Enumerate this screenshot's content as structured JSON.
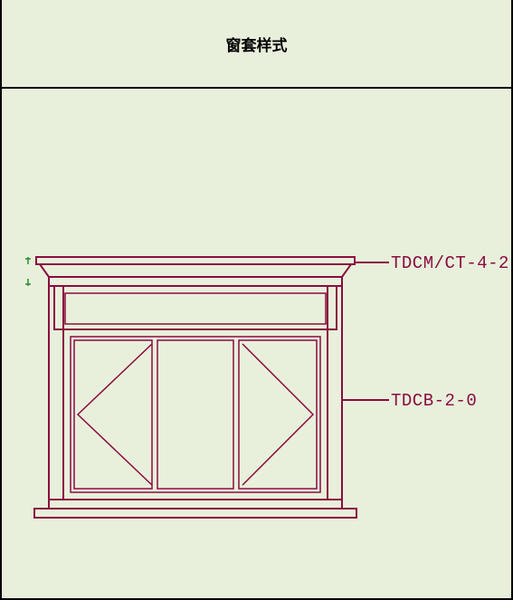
{
  "title": "窗套样式",
  "labels": {
    "top": "TDCM/CT-4-2",
    "side": "TDCB-2-0"
  },
  "colors": {
    "outline": "#8a0c3f",
    "bg": "#e8f0dc"
  }
}
